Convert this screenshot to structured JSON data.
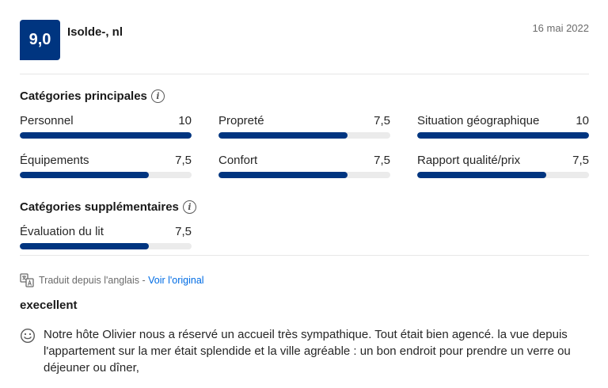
{
  "review": {
    "score": "9,0",
    "reviewer": "Isolde-, nl",
    "date": "16 mai 2022",
    "title": "execellent",
    "text": "Notre hôte Olivier nous a réservé un accueil très sympathique. Tout était bien agencé. la vue depuis l'appartement sur la mer était splendide et la ville agréable : un bon endroit pour prendre un verre ou déjeuner ou dîner,"
  },
  "main_categories": {
    "title": "Catégories principales",
    "info_icon": "i",
    "items": [
      {
        "label": "Personnel",
        "score": "10",
        "fraction": 1.0
      },
      {
        "label": "Propreté",
        "score": "7,5",
        "fraction": 0.75
      },
      {
        "label": "Situation géographique",
        "score": "10",
        "fraction": 1.0
      },
      {
        "label": "Équipements",
        "score": "7,5",
        "fraction": 0.75
      },
      {
        "label": "Confort",
        "score": "7,5",
        "fraction": 0.75
      },
      {
        "label": "Rapport qualité/prix",
        "score": "7,5",
        "fraction": 0.75
      }
    ]
  },
  "extra_categories": {
    "title": "Catégories supplémentaires",
    "info_icon": "i",
    "items": [
      {
        "label": "Évaluation du lit",
        "score": "7,5",
        "fraction": 0.75
      }
    ]
  },
  "translation": {
    "note": "Traduit depuis l'anglais",
    "separator": " - ",
    "link": "Voir l'original"
  },
  "colors": {
    "brand": "#003580",
    "link": "#006ce4",
    "track": "#ebebeb"
  },
  "icons": [
    "info-icon",
    "translate-icon",
    "smile-icon"
  ]
}
